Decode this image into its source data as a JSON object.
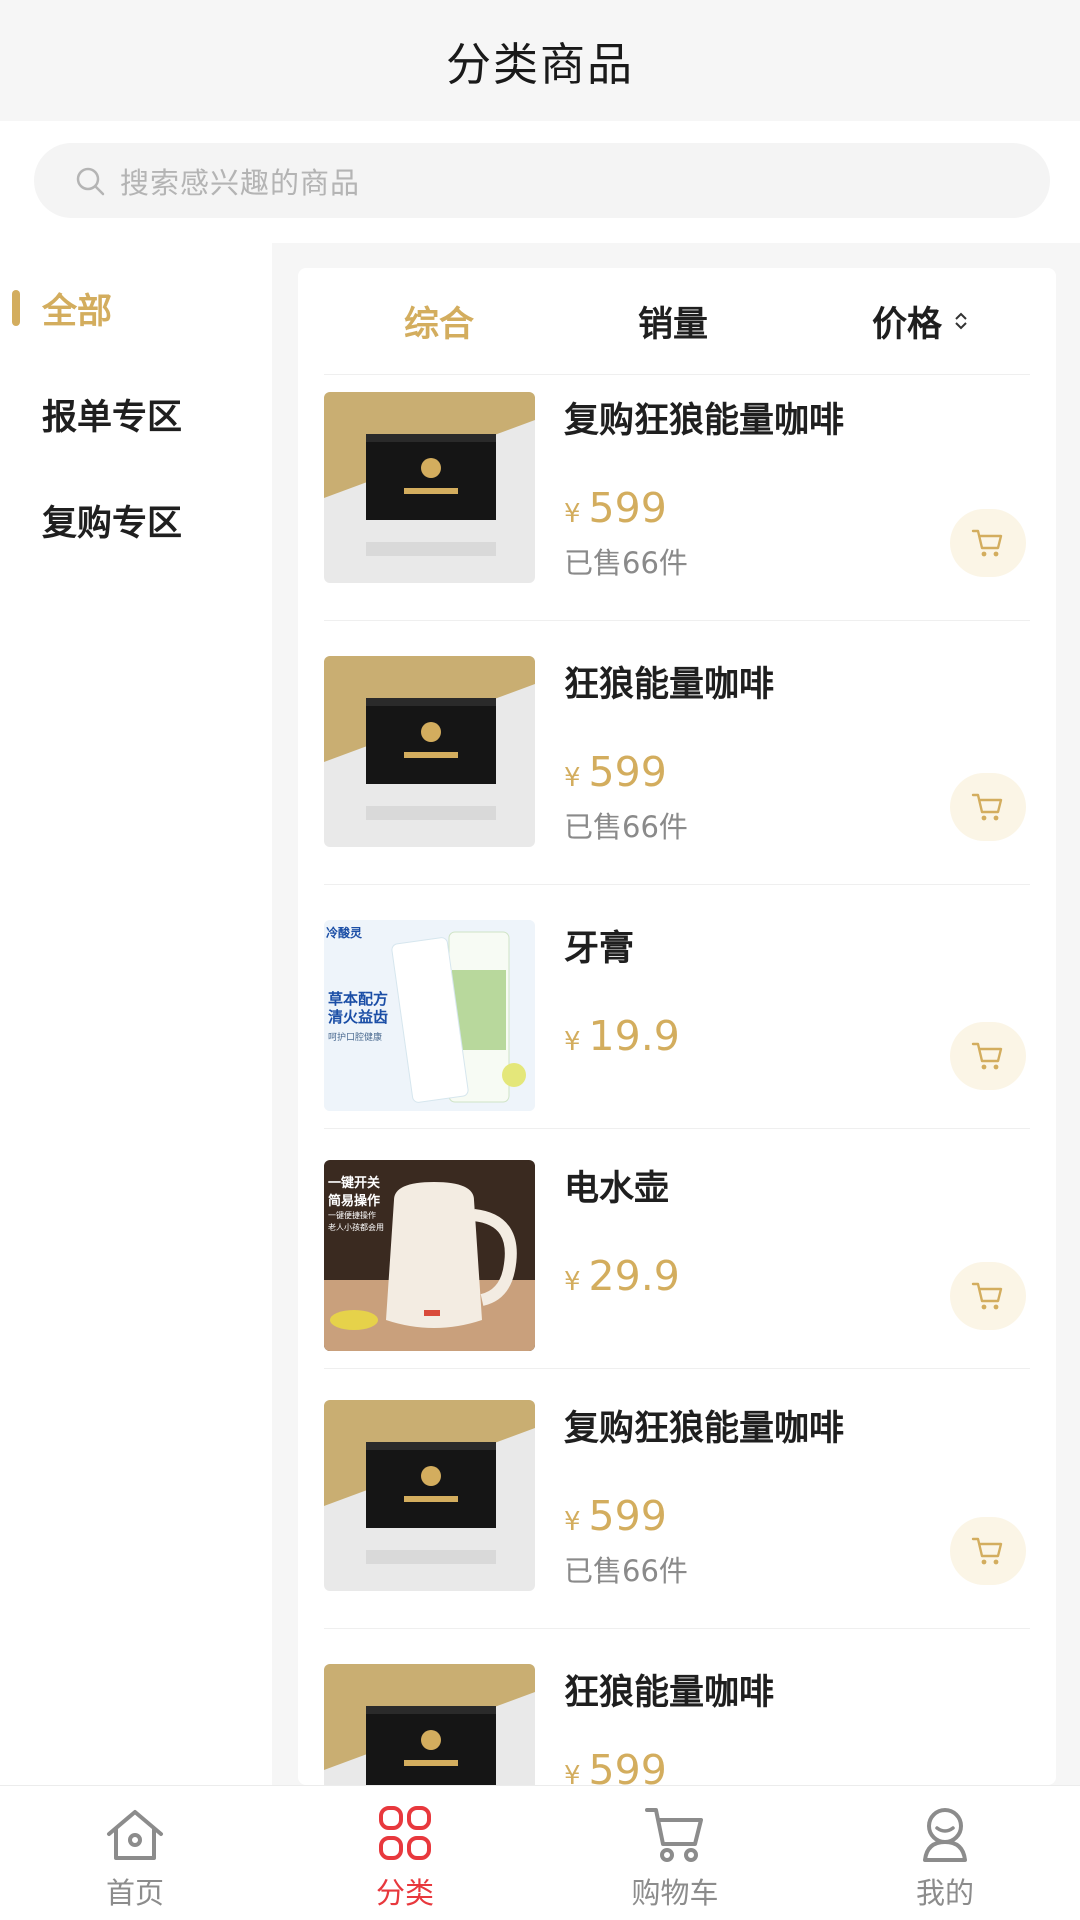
{
  "header": {
    "title": "分类商品"
  },
  "search": {
    "placeholder": "搜索感兴趣的商品",
    "icon": "search-icon"
  },
  "sidebar": {
    "items": [
      {
        "label": "全部",
        "active": true
      },
      {
        "label": "报单专区",
        "active": false
      },
      {
        "label": "复购专区",
        "active": false
      }
    ]
  },
  "sort": {
    "items": [
      {
        "label": "综合",
        "active": true
      },
      {
        "label": "销量",
        "active": false
      },
      {
        "label": "价格",
        "active": false,
        "icon": "sort-arrows-icon"
      }
    ]
  },
  "products": [
    {
      "name": "复购狂狼能量咖啡",
      "currency": "¥",
      "price": "599",
      "sold": "已售66件",
      "image": "coffee-box"
    },
    {
      "name": "狂狼能量咖啡",
      "currency": "¥",
      "price": "599",
      "sold": "已售66件",
      "image": "coffee-box"
    },
    {
      "name": "牙膏",
      "currency": "¥",
      "price": "19.9",
      "sold": "",
      "image": "toothpaste"
    },
    {
      "name": "电水壶",
      "currency": "¥",
      "price": "29.9",
      "sold": "",
      "image": "kettle"
    },
    {
      "name": "复购狂狼能量咖啡",
      "currency": "¥",
      "price": "599",
      "sold": "已售66件",
      "image": "coffee-box"
    },
    {
      "name": "狂狼能量咖啡",
      "currency": "¥",
      "price": "599",
      "sold": "",
      "image": "coffee-box"
    }
  ],
  "product_images": {
    "toothpaste_brand": "冷酸灵",
    "toothpaste_line1": "草本配方",
    "toothpaste_line2": "清火益齿",
    "toothpaste_line3": "呵护口腔健康",
    "kettle_line1": "一键开关",
    "kettle_line2": "简易操作",
    "kettle_line3": "一键便捷操作",
    "kettle_line4": "老人小孩都会用"
  },
  "tabbar": {
    "items": [
      {
        "label": "首页",
        "icon": "home-icon",
        "active": false
      },
      {
        "label": "分类",
        "icon": "category-grid-icon",
        "active": true
      },
      {
        "label": "购物车",
        "icon": "cart-icon",
        "active": false
      },
      {
        "label": "我的",
        "icon": "user-icon",
        "active": false
      }
    ]
  },
  "colors": {
    "accent": "#d3ad5e",
    "tab_active": "#e8383d",
    "background": "#f6f6f6"
  }
}
